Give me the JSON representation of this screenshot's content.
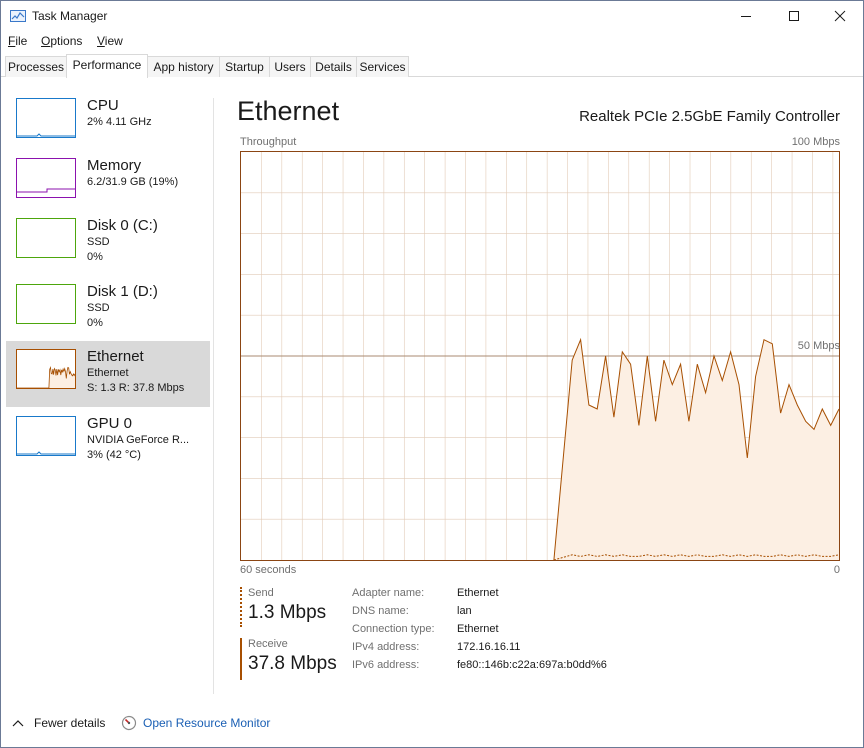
{
  "window": {
    "title": "Task Manager"
  },
  "menu": [
    "File",
    "Options",
    "View"
  ],
  "tabs": [
    {
      "label": "Processes",
      "active": false
    },
    {
      "label": "Performance",
      "active": true
    },
    {
      "label": "App history",
      "active": false
    },
    {
      "label": "Startup",
      "active": false
    },
    {
      "label": "Users",
      "active": false
    },
    {
      "label": "Details",
      "active": false
    },
    {
      "label": "Services",
      "active": false
    }
  ],
  "sidebar": {
    "items": [
      {
        "title": "CPU",
        "line1": "2% 4.11 GHz",
        "line2": "",
        "color": "#1979ca",
        "selected": false
      },
      {
        "title": "Memory",
        "line1": "6.2/31.9 GB (19%)",
        "line2": "",
        "color": "#8b12ae",
        "selected": false
      },
      {
        "title": "Disk 0 (C:)",
        "line1": "SSD",
        "line2": "0%",
        "color": "#4da60c",
        "selected": false
      },
      {
        "title": "Disk 1 (D:)",
        "line1": "SSD",
        "line2": "0%",
        "color": "#4da60c",
        "selected": false
      },
      {
        "title": "Ethernet",
        "line1": "Ethernet",
        "line2": "S: 1.3  R: 37.8 Mbps",
        "color": "#a74f01",
        "selected": true
      },
      {
        "title": "GPU 0",
        "line1": "NVIDIA GeForce R...",
        "line2": "3% (42 °C)",
        "color": "#1979ca",
        "selected": false
      }
    ]
  },
  "main": {
    "title": "Ethernet",
    "adapter": "Realtek PCIe 2.5GbE Family Controller",
    "graph": {
      "top_left": "Throughput",
      "top_right": "100 Mbps",
      "mid_right": "50 Mbps",
      "bottom_left": "60 seconds",
      "bottom_right": "0",
      "max_mbps": 100,
      "line_color": "#a74f01",
      "fill_color": "#fcefe3",
      "receive_mbps": [
        0,
        0,
        0,
        0,
        0,
        0,
        0,
        0,
        0,
        0,
        0,
        0,
        0,
        0,
        0,
        0,
        0,
        0,
        0,
        0,
        0,
        0,
        0,
        0,
        0,
        0,
        0,
        0,
        0,
        0,
        0,
        0,
        0,
        0,
        0,
        0,
        0,
        0,
        0,
        0,
        0,
        0,
        0,
        0,
        0,
        0,
        0,
        0,
        0,
        0,
        0,
        0,
        0,
        0,
        0,
        0,
        0,
        0,
        0,
        0,
        0,
        0,
        0,
        0,
        0,
        0,
        0,
        0,
        0,
        0,
        0,
        0,
        0,
        0,
        0,
        0,
        0,
        0,
        0,
        0,
        0,
        0,
        0,
        0,
        0,
        0,
        0,
        0,
        0,
        0,
        0,
        0,
        0,
        0,
        0,
        0,
        0,
        0,
        0,
        0,
        0,
        0,
        0,
        0,
        0,
        0,
        0,
        0,
        0,
        0,
        0,
        0,
        0,
        0,
        0,
        0,
        0,
        0,
        0,
        0,
        0,
        0,
        0,
        0,
        0,
        0,
        0,
        0,
        0,
        0,
        0,
        0,
        0,
        0,
        0,
        0,
        0,
        0,
        0,
        0,
        0,
        0,
        0,
        0,
        0,
        0,
        0,
        0,
        0,
        0,
        0,
        0,
        0,
        0,
        0,
        0,
        0,
        0,
        0,
        0,
        0,
        0,
        0,
        0,
        0,
        0,
        0,
        0,
        0,
        0
      ],
      "receive_series": [
        0,
        49,
        54,
        38,
        37,
        50,
        35,
        51,
        48,
        33,
        50,
        34,
        49,
        43,
        48,
        34,
        48,
        41,
        50,
        44,
        51,
        43,
        25,
        45,
        54,
        53,
        36,
        43,
        38,
        34,
        32,
        37,
        33,
        37
      ],
      "receive_start_seconds": 33,
      "send_series": [
        1,
        2,
        1,
        2,
        1,
        2,
        1,
        2,
        1,
        1,
        2,
        1,
        2,
        1,
        2,
        1,
        2,
        1,
        1,
        2,
        1,
        2,
        1,
        2,
        1,
        1,
        2,
        1,
        2,
        1,
        2,
        1,
        1,
        2
      ]
    },
    "send": {
      "label": "Send",
      "value": "1.3 Mbps",
      "color": "#a74f01"
    },
    "receive": {
      "label": "Receive",
      "value": "37.8 Mbps",
      "color": "#a74f01"
    },
    "details": [
      {
        "key": "Adapter name:",
        "value": "Ethernet"
      },
      {
        "key": "DNS name:",
        "value": "lan"
      },
      {
        "key": "Connection type:",
        "value": "Ethernet"
      },
      {
        "key": "IPv4 address:",
        "value": "172.16.16.11"
      },
      {
        "key": "IPv6 address:",
        "value": "fe80::146b:c22a:697a:b0dd%6"
      }
    ]
  },
  "footer": {
    "fewer_details": "Fewer details",
    "open_resource_monitor": "Open Resource Monitor"
  }
}
